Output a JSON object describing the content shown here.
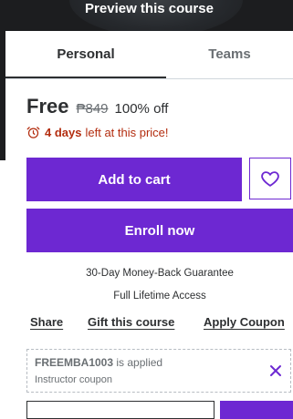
{
  "preview": {
    "label": "Preview this course"
  },
  "tabs": [
    {
      "label": "Personal",
      "active": true
    },
    {
      "label": "Teams",
      "active": false
    }
  ],
  "pricing": {
    "current": "Free",
    "original": "₱849",
    "discount": "100% off"
  },
  "timer": {
    "icon": "alarm-clock-icon",
    "days": "4 days",
    "rest": "left at this price!"
  },
  "actions": {
    "add_to_cart": "Add to cart",
    "wishlist_icon": "heart-icon",
    "enroll": "Enroll now"
  },
  "guarantee": "30-Day Money-Back Guarantee",
  "lifetime": "Full Lifetime Access",
  "links": {
    "share": "Share",
    "gift": "Gift this course",
    "coupon": "Apply Coupon"
  },
  "coupon": {
    "code": "FREEMBA1003",
    "status": "is applied",
    "type": "Instructor coupon",
    "remove_icon": "close-icon"
  },
  "colors": {
    "accent": "#6d28d2",
    "text": "#2d2f31",
    "muted": "#6a6f73",
    "urgency": "#b32d0f",
    "dark": "#1c1d1f"
  }
}
